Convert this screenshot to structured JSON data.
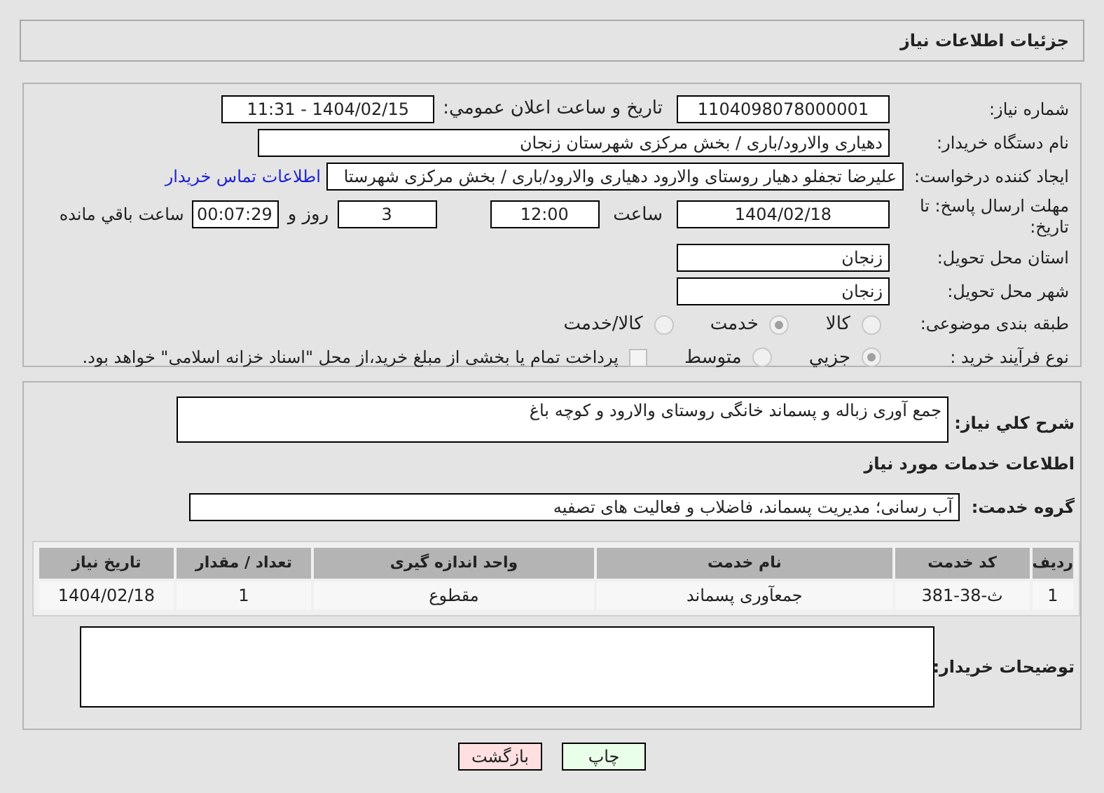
{
  "header": {
    "title": "جزئیات اطلاعات نیاز"
  },
  "need_number": {
    "label": "شماره نیاز:",
    "value": "1104098078000001"
  },
  "announce": {
    "label": "تاریخ و ساعت اعلان عمومي:",
    "value": "1404/02/15 - 11:31"
  },
  "buyer_org": {
    "label": "نام دستگاه خریدار:",
    "value": "دهیاری والارود/باری / بخش مرکزی شهرستان زنجان"
  },
  "requester": {
    "label": "ایجاد کننده درخواست:",
    "value": "علیرضا تجفلو دهیار روستای والارود دهیاری والارود/باری / بخش مرکزی شهرستا",
    "link": "اطلاعات تماس خریدار"
  },
  "deadline": {
    "label": "مهلت ارسال پاسخ: تا تاریخ:",
    "date": "1404/02/18",
    "time_label": "ساعت",
    "time": "12:00",
    "days": "3",
    "days_label": "روز و",
    "remaining": "00:07:29",
    "remaining_label": "ساعت باقي مانده"
  },
  "province": {
    "label": "استان محل تحویل:",
    "value": "زنجان"
  },
  "city": {
    "label": "شهر محل تحویل:",
    "value": "زنجان"
  },
  "category": {
    "label": "طبقه بندی موضوعی:",
    "options": [
      {
        "label": "کالا",
        "selected": false
      },
      {
        "label": "خدمت",
        "selected": true
      },
      {
        "label": "کالا/خدمت",
        "selected": false
      }
    ]
  },
  "purchase_type": {
    "label": "نوع فرآیند خرید :",
    "options": [
      {
        "label": "جزیي",
        "selected": true
      },
      {
        "label": "متوسط",
        "selected": false
      }
    ],
    "treasury": {
      "label": "پرداخت تمام یا بخشی از مبلغ خرید،از محل \"اسناد خزانه اسلامی\" خواهد بود.",
      "checked": false
    }
  },
  "description": {
    "label": "شرح کلي نياز:",
    "value": "جمع آوری زباله و پسماند خانگی روستای والارود و کوچه باغ"
  },
  "services_heading": "اطلاعات خدمات مورد نیاز",
  "service_group": {
    "label": "گروه خدمت:",
    "value": "آب رسانی؛ مدیریت پسماند، فاضلاب و فعالیت های تصفیه"
  },
  "table": {
    "columns": [
      "ردیف",
      "کد خدمت",
      "نام خدمت",
      "واحد اندازه گیری",
      "تعداد / مقدار",
      "تاریخ نیاز"
    ],
    "rows": [
      [
        "1",
        "ث-38-381",
        "جمعآوری پسماند",
        "مقطوع",
        "1",
        "1404/02/18"
      ]
    ]
  },
  "buyer_notes": {
    "label": "توضیحات خریدار:"
  },
  "buttons": [
    {
      "label": "چاپ",
      "kind": "print"
    },
    {
      "label": "بازگشت",
      "kind": "back"
    }
  ]
}
